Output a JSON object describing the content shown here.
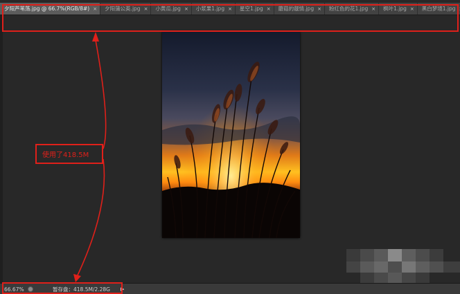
{
  "tabs": [
    {
      "label": "夕阳芦苇荡.jpg @ 66.7%(RGB/8#)",
      "active": true
    },
    {
      "label": "夕阳蒲公英.jpg",
      "active": false
    },
    {
      "label": "小黄瓜.jpg",
      "active": false
    },
    {
      "label": "小浆果1.jpg",
      "active": false
    },
    {
      "label": "星空1.jpg",
      "active": false
    },
    {
      "label": "蘑菇的靓情.jpg",
      "active": false
    },
    {
      "label": "粉红色的花1.jpg",
      "active": false
    },
    {
      "label": "枫叶1.jpg",
      "active": false
    },
    {
      "label": "黑白梦境1.jpg",
      "active": false
    }
  ],
  "tab_close_glyph": "×",
  "tab_overflow_glyph": "»",
  "status": {
    "zoom": "66.67%",
    "scratch": "暂存盘：418.5M/2.28G",
    "arrow": "▶"
  },
  "annotation": {
    "label": "使用了418.5M",
    "color": "#e0201a"
  },
  "icons": {
    "status": "info-circle-icon",
    "close": "close-icon"
  }
}
